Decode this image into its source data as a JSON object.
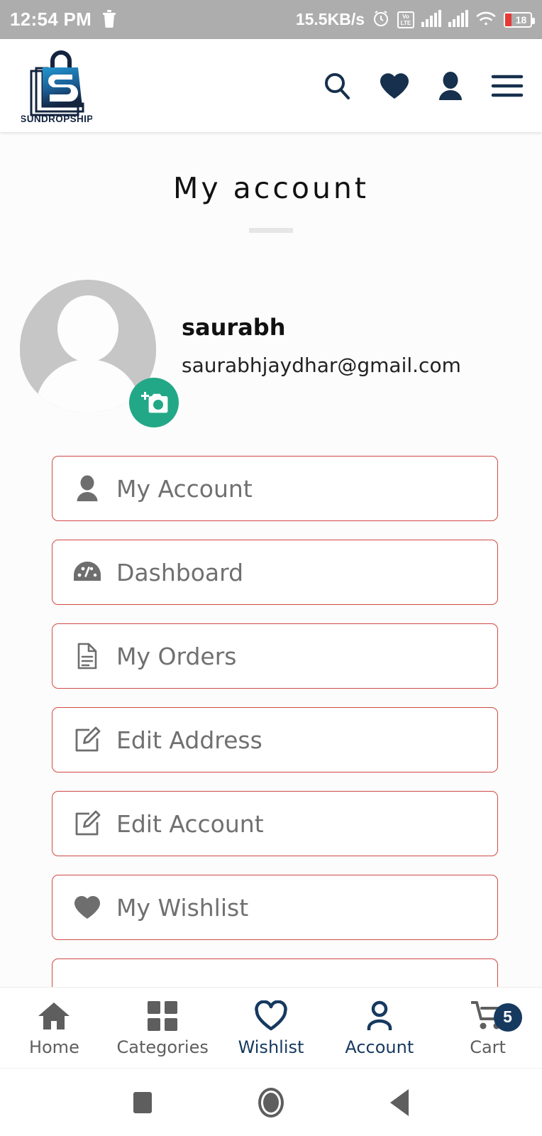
{
  "status_bar": {
    "time": "12:54 PM",
    "trash_icon": "trash-icon",
    "network_speed": "15.5KB/s",
    "alarm_icon": "alarm-icon",
    "volte_top": "Vo",
    "volte_bottom": "LTE",
    "battery_percent": "18"
  },
  "header": {
    "logo_text": "SUNDROPSHIP",
    "icons": [
      {
        "name": "search-icon"
      },
      {
        "name": "heart-icon"
      },
      {
        "name": "person-icon"
      },
      {
        "name": "hamburger-menu-icon"
      }
    ]
  },
  "page": {
    "title": "My account"
  },
  "profile": {
    "name": "saurabh",
    "email": "saurabhjaydhar@gmail.com",
    "camera_button": "add-photo-icon"
  },
  "menu": {
    "items": [
      {
        "label": "My Account",
        "icon": "person-icon"
      },
      {
        "label": "Dashboard",
        "icon": "gauge-icon"
      },
      {
        "label": "My Orders",
        "icon": "document-icon"
      },
      {
        "label": "Edit Address",
        "icon": "edit-icon"
      },
      {
        "label": "Edit Account",
        "icon": "edit-icon"
      },
      {
        "label": "My Wishlist",
        "icon": "heart-icon"
      }
    ]
  },
  "bottom_nav": {
    "items": [
      {
        "label": "Home",
        "icon": "home-icon",
        "active": false
      },
      {
        "label": "Categories",
        "icon": "grid-icon",
        "active": false
      },
      {
        "label": "Wishlist",
        "icon": "heart-outline-icon",
        "active": true
      },
      {
        "label": "Account",
        "icon": "account-icon",
        "active": true
      },
      {
        "label": "Cart",
        "icon": "cart-icon",
        "active": false,
        "badge": "5"
      }
    ]
  },
  "colors": {
    "brand_navy": "#16395f",
    "card_border_red": "#cf4a45",
    "camera_green": "#23a887",
    "status_bar_gray": "#adadad"
  }
}
